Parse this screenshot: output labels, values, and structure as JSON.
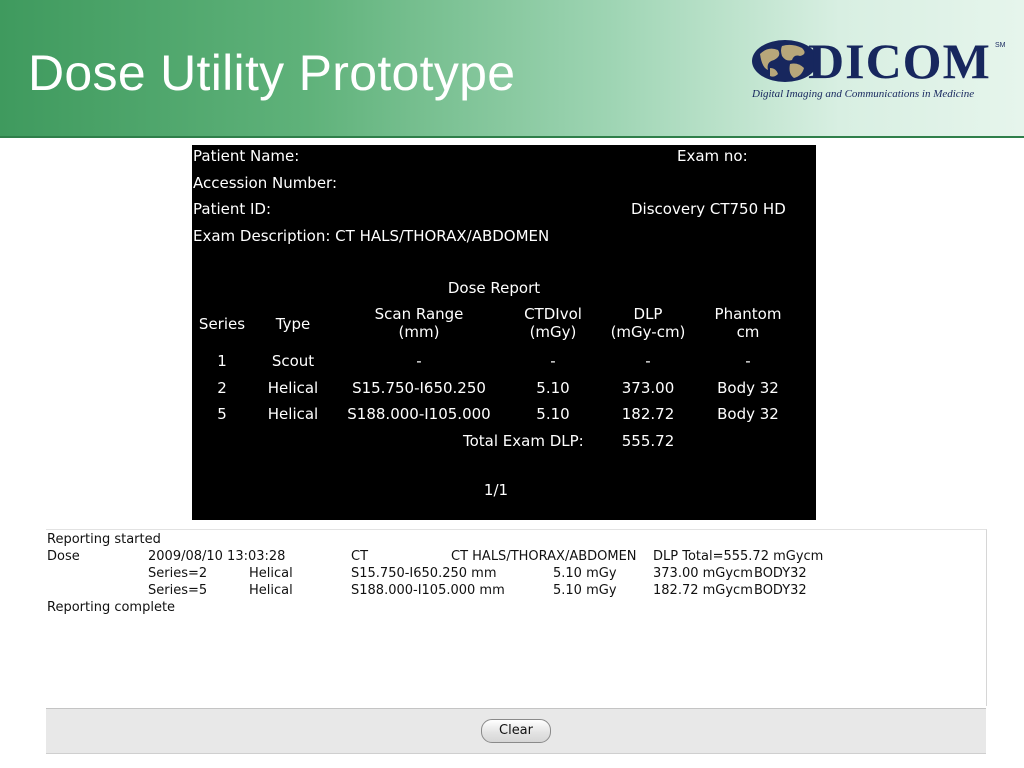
{
  "slide": {
    "title": "Dose Utility Prototype",
    "logo": {
      "word": "DICOM",
      "sm": "SM",
      "tagline": "Digital Imaging and Communications in Medicine"
    }
  },
  "report": {
    "patient_name_label": "Patient Name:",
    "exam_no_label": "Exam no:",
    "accession_label": "Accession Number:",
    "patient_id_label": "Patient ID:",
    "scanner": "Discovery CT750 HD",
    "exam_description": "Exam Description: CT HALS/THORAX/ABDOMEN",
    "heading": "Dose Report",
    "columns": {
      "series": "Series",
      "type": "Type",
      "scan_range_1": "Scan Range",
      "scan_range_2": "(mm)",
      "ctdi_1": "CTDIvol",
      "ctdi_2": "(mGy)",
      "dlp_1": "DLP",
      "dlp_2": "(mGy-cm)",
      "phantom_1": "Phantom",
      "phantom_2": "cm"
    },
    "rows": [
      {
        "series": "1",
        "type": "Scout",
        "range": "-",
        "ctdi": "-",
        "dlp": "-",
        "phantom": "-"
      },
      {
        "series": "2",
        "type": "Helical",
        "range": "S15.750-I650.250",
        "ctdi": "5.10",
        "dlp": "373.00",
        "phantom": "Body 32"
      },
      {
        "series": "5",
        "type": "Helical",
        "range": "S188.000-I105.000",
        "ctdi": "5.10",
        "dlp": "182.72",
        "phantom": "Body 32"
      }
    ],
    "total_label": "Total Exam DLP:",
    "total_value": "555.72",
    "page": "1/1"
  },
  "log": {
    "started": "Reporting started",
    "dose_label": "Dose",
    "datetime": "2009/08/10 13:03:28",
    "modality": "CT",
    "description": "CT HALS/THORAX/ABDOMEN",
    "dlp_total": "DLP Total=555.72 mGycm",
    "entries": [
      {
        "series": "Series=2",
        "type": "Helical",
        "range": "S15.750-I650.250 mm",
        "ctdi": "5.10 mGy",
        "dlp": "373.00 mGycm",
        "phantom": "BODY32"
      },
      {
        "series": "Series=5",
        "type": "Helical",
        "range": "S188.000-I105.000 mm",
        "ctdi": "5.10 mGy",
        "dlp": "182.72 mGycm",
        "phantom": "BODY32"
      }
    ],
    "complete": "Reporting complete"
  },
  "buttons": {
    "clear": "Clear"
  }
}
